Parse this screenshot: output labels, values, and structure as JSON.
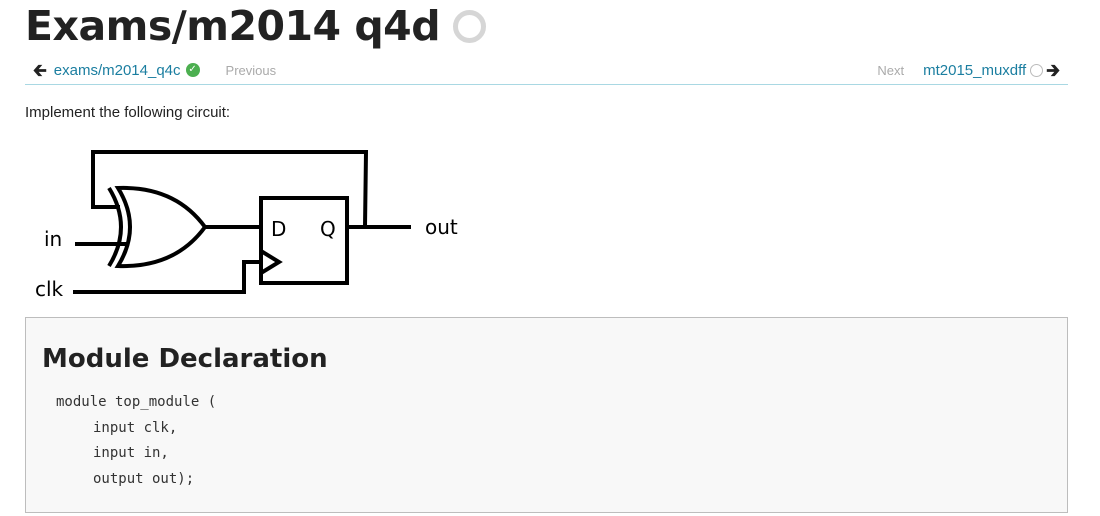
{
  "page": {
    "title": "Exams/m2014 q4d"
  },
  "nav": {
    "prev_link": "exams/m2014_q4c",
    "prev_label": "Previous",
    "next_label": "Next",
    "next_link": "mt2015_muxdff"
  },
  "icons": {
    "title_status": "circle-outline-icon",
    "prev_arrow": "arrow-left-icon",
    "prev_status": "check-circle-icon",
    "next_status": "circle-outline-icon",
    "next_arrow": "arrow-right-icon"
  },
  "colors": {
    "link": "#1b7ea0",
    "solved": "#4caf50",
    "divider": "#a9d8e3"
  },
  "content": {
    "intro": "Implement the following circuit:"
  },
  "circuit": {
    "labels": {
      "in": "in",
      "clk": "clk",
      "out": "out",
      "d": "D",
      "q": "Q"
    }
  },
  "module": {
    "heading": "Module Declaration",
    "code_lines": [
      "module top_module (",
      "input clk,",
      "input in,",
      "output out);"
    ]
  }
}
